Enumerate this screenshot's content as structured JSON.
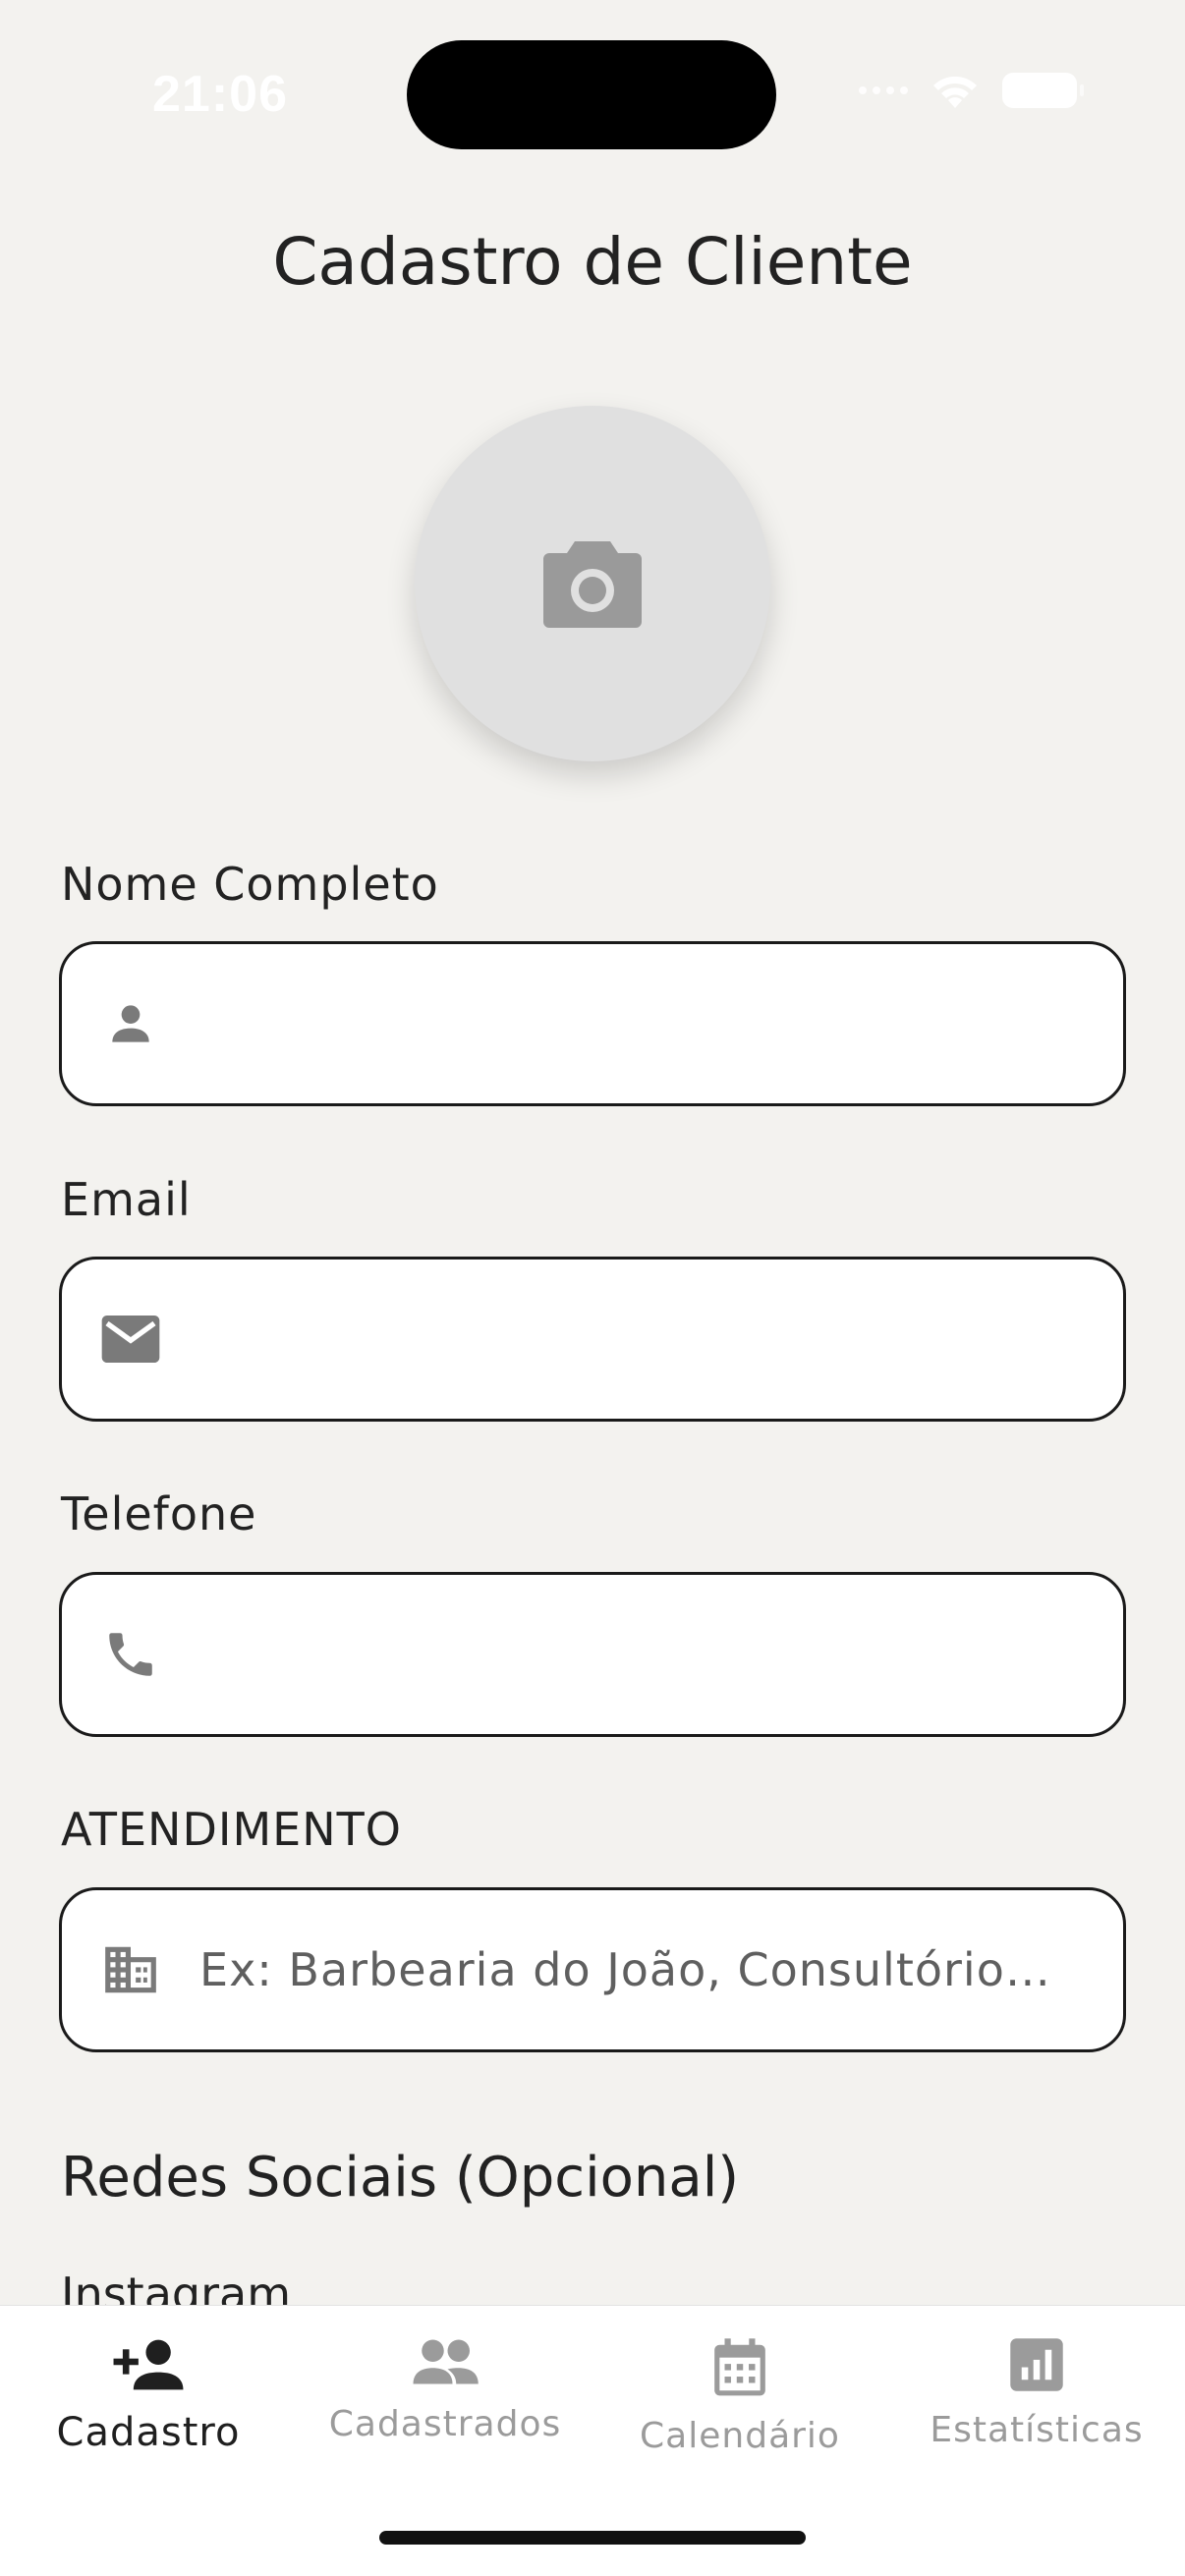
{
  "status_bar": {
    "time": "21:06"
  },
  "header": {
    "title": "Cadastro de Cliente"
  },
  "avatar": {
    "icon": "camera-icon"
  },
  "form": {
    "name": {
      "label": "Nome Completo",
      "icon": "person-icon",
      "value": "",
      "placeholder": ""
    },
    "email": {
      "label": "Email",
      "icon": "mail-icon",
      "value": "",
      "placeholder": ""
    },
    "phone": {
      "label": "Telefone",
      "icon": "phone-icon",
      "value": "",
      "placeholder": ""
    },
    "atendimento": {
      "label": "ATENDIMENTO",
      "icon": "building-icon",
      "value": "",
      "placeholder": "Ex: Barbearia do João, Consultório…"
    }
  },
  "social": {
    "title": "Redes Sociais (Opcional)",
    "instagram_label": "Instagram"
  },
  "nav": {
    "items": [
      {
        "label": "Cadastro",
        "icon": "person-add-icon",
        "active": true
      },
      {
        "label": "Cadastrados",
        "icon": "people-icon",
        "active": false
      },
      {
        "label": "Calendário",
        "icon": "calendar-icon",
        "active": false
      },
      {
        "label": "Estatísticas",
        "icon": "stats-icon",
        "active": false
      }
    ]
  },
  "colors": {
    "background": "#f3f2ef",
    "field_border": "#1a1a1a",
    "icon_gray": "#7a7a7a",
    "nav_inactive": "#9b9b9b"
  }
}
